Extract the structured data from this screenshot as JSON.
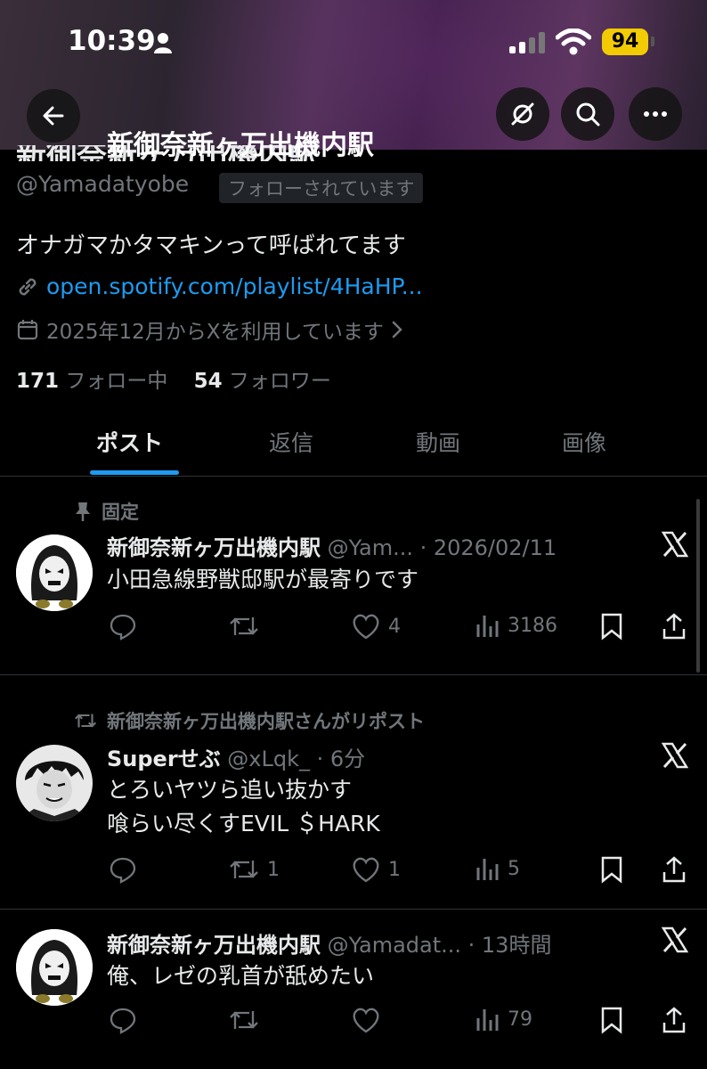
{
  "status_bar": {
    "time": "10:39",
    "battery": "94"
  },
  "profile": {
    "name": "新御奈新ヶ万出機内駅",
    "handle": "@Yamadatyobe",
    "follows_you": "フォローされています",
    "bio": "オナガマかタマキンって呼ばれてます",
    "link": "open.spotify.com/playlist/4HaHP...",
    "joined": "2025年12月からXを利用しています",
    "following_count": "171",
    "following_label": "フォロー中",
    "followers_count": "54",
    "followers_label": "フォロワー"
  },
  "tabs": [
    "ポスト",
    "返信",
    "動画",
    "画像"
  ],
  "posts": [
    {
      "meta": "固定",
      "name": "新御奈新ヶ万出機内駅",
      "rest": " @Yam... · 2026/02/11",
      "lines": [
        "小田急線野獣邸駅が最寄りです"
      ],
      "reply": "",
      "repost": "",
      "like": "4",
      "views": "3186"
    },
    {
      "meta": "新御奈新ヶ万出機内駅さんがリポスト",
      "name": "Superせぶ",
      "rest": " @xLqk_ · 6分",
      "lines": [
        "とろいヤツら追い抜かす",
        "喰らい尽くすEVIL ＄HARK"
      ],
      "reply": "",
      "repost": "1",
      "like": "1",
      "views": "5"
    },
    {
      "meta": "",
      "name": "新御奈新ヶ万出機内駅",
      "rest": " @Yamadat... · 13時間",
      "lines": [
        "俺、レゼの乳首が舐めたい"
      ],
      "reply": "",
      "repost": "",
      "like": "",
      "views": "79"
    }
  ]
}
